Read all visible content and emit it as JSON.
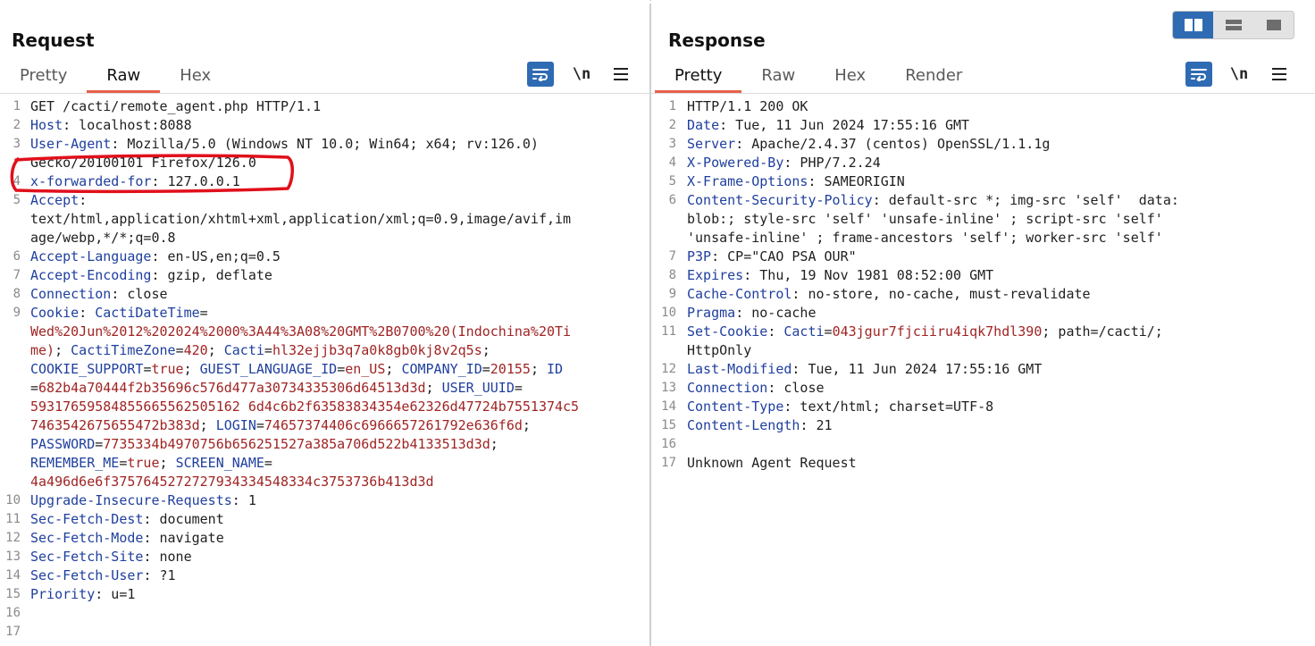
{
  "request": {
    "title": "Request",
    "tabs": [
      {
        "label": "Pretty",
        "active": false
      },
      {
        "label": "Raw",
        "active": true
      },
      {
        "label": "Hex",
        "active": false
      }
    ],
    "lines": [
      {
        "num": "1",
        "parts": [
          [
            "v",
            "GET /cacti/remote_agent.php HTTP/1.1"
          ]
        ]
      },
      {
        "num": "2",
        "parts": [
          [
            "k",
            "Host"
          ],
          [
            "v",
            ": localhost:8088"
          ]
        ]
      },
      {
        "num": "3",
        "parts": [
          [
            "k",
            "User-Agent"
          ],
          [
            "v",
            ": Mozilla/5.0 (Windows NT 10.0; Win64; x64; rv:126.0)"
          ]
        ]
      },
      {
        "num": "",
        "parts": [
          [
            "v",
            "Gecko/20100101 Firefox/126.0"
          ]
        ]
      },
      {
        "num": "4",
        "parts": [
          [
            "k",
            "x-forwarded-for"
          ],
          [
            "v",
            ": 127.0.0.1"
          ]
        ]
      },
      {
        "num": "5",
        "parts": [
          [
            "k",
            "Accept"
          ],
          [
            "v",
            ":"
          ]
        ]
      },
      {
        "num": "",
        "parts": [
          [
            "v",
            "text/html,application/xhtml+xml,application/xml;q=0.9,image/avif,im"
          ]
        ]
      },
      {
        "num": "",
        "parts": [
          [
            "v",
            "age/webp,*/*;q=0.8"
          ]
        ]
      },
      {
        "num": "6",
        "parts": [
          [
            "k",
            "Accept-Language"
          ],
          [
            "v",
            ": en-US,en;q=0.5"
          ]
        ]
      },
      {
        "num": "7",
        "parts": [
          [
            "k",
            "Accept-Encoding"
          ],
          [
            "v",
            ": gzip, deflate"
          ]
        ]
      },
      {
        "num": "8",
        "parts": [
          [
            "k",
            "Connection"
          ],
          [
            "v",
            ": close"
          ]
        ]
      },
      {
        "num": "9",
        "parts": [
          [
            "k",
            "Cookie"
          ],
          [
            "v",
            ": "
          ],
          [
            "k",
            "CactiDateTime"
          ],
          [
            "v",
            "="
          ]
        ]
      },
      {
        "num": "",
        "parts": [
          [
            "c",
            "Wed%20Jun%2012%202024%2000%3A44%3A08%20GMT%2B0700%20(Indochina%20Ti"
          ]
        ]
      },
      {
        "num": "",
        "parts": [
          [
            "c",
            "me)"
          ],
          [
            "v",
            "; "
          ],
          [
            "k",
            "CactiTimeZone"
          ],
          [
            "v",
            "="
          ],
          [
            "c",
            "420"
          ],
          [
            "v",
            "; "
          ],
          [
            "k",
            "Cacti"
          ],
          [
            "v",
            "="
          ],
          [
            "c",
            "hl32ejjb3q7a0k8gb0kj8v2q5s"
          ],
          [
            "v",
            ";"
          ]
        ]
      },
      {
        "num": "",
        "parts": [
          [
            "k",
            "COOKIE_SUPPORT"
          ],
          [
            "v",
            "="
          ],
          [
            "c",
            "true"
          ],
          [
            "v",
            "; "
          ],
          [
            "k",
            "GUEST_LANGUAGE_ID"
          ],
          [
            "v",
            "="
          ],
          [
            "c",
            "en_US"
          ],
          [
            "v",
            "; "
          ],
          [
            "k",
            "COMPANY_ID"
          ],
          [
            "v",
            "="
          ],
          [
            "c",
            "20155"
          ],
          [
            "v",
            "; "
          ],
          [
            "k",
            "ID"
          ]
        ]
      },
      {
        "num": "",
        "parts": [
          [
            "v",
            "="
          ],
          [
            "c",
            "682b4a70444f2b35696c576d477a30734335306d64513d3d"
          ],
          [
            "v",
            "; "
          ],
          [
            "k",
            "USER_UUID"
          ],
          [
            "v",
            "="
          ]
        ]
      },
      {
        "num": "",
        "parts": [
          [
            "c",
            "59317659584855665562505162 6d4c6b2f63583834354e62326d47724b7551374c5"
          ]
        ]
      },
      {
        "num": "",
        "parts": [
          [
            "c",
            "7463542675655472b383d"
          ],
          [
            "v",
            "; "
          ],
          [
            "k",
            "LOGIN"
          ],
          [
            "v",
            "="
          ],
          [
            "c",
            "74657374406c6966657261792e636f6d"
          ],
          [
            "v",
            ";"
          ]
        ]
      },
      {
        "num": "",
        "parts": [
          [
            "k",
            "PASSWORD"
          ],
          [
            "v",
            "="
          ],
          [
            "c",
            "7735334b4970756b656251527a385a706d522b4133513d3d"
          ],
          [
            "v",
            ";"
          ]
        ]
      },
      {
        "num": "",
        "parts": [
          [
            "k",
            "REMEMBER_ME"
          ],
          [
            "v",
            "="
          ],
          [
            "c",
            "true"
          ],
          [
            "v",
            "; "
          ],
          [
            "k",
            "SCREEN_NAME"
          ],
          [
            "v",
            "="
          ]
        ]
      },
      {
        "num": "",
        "parts": [
          [
            "c",
            "4a496d6e6f3757645272727934334548334c3753736b413d3d"
          ]
        ]
      },
      {
        "num": "10",
        "parts": [
          [
            "k",
            "Upgrade-Insecure-Requests"
          ],
          [
            "v",
            ": 1"
          ]
        ]
      },
      {
        "num": "11",
        "parts": [
          [
            "k",
            "Sec-Fetch-Dest"
          ],
          [
            "v",
            ": document"
          ]
        ]
      },
      {
        "num": "12",
        "parts": [
          [
            "k",
            "Sec-Fetch-Mode"
          ],
          [
            "v",
            ": navigate"
          ]
        ]
      },
      {
        "num": "13",
        "parts": [
          [
            "k",
            "Sec-Fetch-Site"
          ],
          [
            "v",
            ": none"
          ]
        ]
      },
      {
        "num": "14",
        "parts": [
          [
            "k",
            "Sec-Fetch-User"
          ],
          [
            "v",
            ": ?1"
          ]
        ]
      },
      {
        "num": "15",
        "parts": [
          [
            "k",
            "Priority"
          ],
          [
            "v",
            ": u=1"
          ]
        ]
      },
      {
        "num": "16",
        "parts": []
      },
      {
        "num": "17",
        "parts": []
      }
    ]
  },
  "response": {
    "title": "Response",
    "tabs": [
      {
        "label": "Pretty",
        "active": true
      },
      {
        "label": "Raw",
        "active": false
      },
      {
        "label": "Hex",
        "active": false
      },
      {
        "label": "Render",
        "active": false
      }
    ],
    "lines": [
      {
        "num": "1",
        "parts": [
          [
            "v",
            "HTTP/1.1 200 OK"
          ]
        ],
        "highlight": true
      },
      {
        "num": "2",
        "parts": [
          [
            "k",
            "Date"
          ],
          [
            "v",
            ": Tue, 11 Jun 2024 17:55:16 GMT"
          ]
        ]
      },
      {
        "num": "3",
        "parts": [
          [
            "k",
            "Server"
          ],
          [
            "v",
            ": Apache/2.4.37 (centos) OpenSSL/1.1.1g"
          ]
        ]
      },
      {
        "num": "4",
        "parts": [
          [
            "k",
            "X-Powered-By"
          ],
          [
            "v",
            ": PHP/7.2.24"
          ]
        ]
      },
      {
        "num": "5",
        "parts": [
          [
            "k",
            "X-Frame-Options"
          ],
          [
            "v",
            ": SAMEORIGIN"
          ]
        ]
      },
      {
        "num": "6",
        "parts": [
          [
            "k",
            "Content-Security-Policy"
          ],
          [
            "v",
            ": default-src *; img-src 'self'  data:"
          ]
        ]
      },
      {
        "num": "",
        "parts": [
          [
            "v",
            "blob:; style-src 'self' 'unsafe-inline' ; script-src 'self'"
          ]
        ]
      },
      {
        "num": "",
        "parts": [
          [
            "v",
            "'unsafe-inline' ; frame-ancestors 'self'; worker-src 'self'"
          ]
        ]
      },
      {
        "num": "7",
        "parts": [
          [
            "k",
            "P3P"
          ],
          [
            "v",
            ": CP=\"CAO PSA OUR\""
          ]
        ]
      },
      {
        "num": "8",
        "parts": [
          [
            "k",
            "Expires"
          ],
          [
            "v",
            ": Thu, 19 Nov 1981 08:52:00 GMT"
          ]
        ]
      },
      {
        "num": "9",
        "parts": [
          [
            "k",
            "Cache-Control"
          ],
          [
            "v",
            ": no-store, no-cache, must-revalidate"
          ]
        ]
      },
      {
        "num": "10",
        "parts": [
          [
            "k",
            "Pragma"
          ],
          [
            "v",
            ": no-cache"
          ]
        ]
      },
      {
        "num": "11",
        "parts": [
          [
            "k",
            "Set-Cookie"
          ],
          [
            "v",
            ": "
          ],
          [
            "k",
            "Cacti"
          ],
          [
            "v",
            "="
          ],
          [
            "c",
            "043jgur7fjciiru4iqk7hdl390"
          ],
          [
            "v",
            "; path=/cacti/;"
          ]
        ]
      },
      {
        "num": "",
        "parts": [
          [
            "v",
            "HttpOnly"
          ]
        ]
      },
      {
        "num": "12",
        "parts": [
          [
            "k",
            "Last-Modified"
          ],
          [
            "v",
            ": Tue, 11 Jun 2024 17:55:16 GMT"
          ]
        ]
      },
      {
        "num": "13",
        "parts": [
          [
            "k",
            "Connection"
          ],
          [
            "v",
            ": close"
          ]
        ]
      },
      {
        "num": "14",
        "parts": [
          [
            "k",
            "Content-Type"
          ],
          [
            "v",
            ": text/html; charset=UTF-8"
          ]
        ]
      },
      {
        "num": "15",
        "parts": [
          [
            "k",
            "Content-Length"
          ],
          [
            "v",
            ": 21"
          ]
        ]
      },
      {
        "num": "16",
        "parts": []
      },
      {
        "num": "17",
        "parts": [
          [
            "v",
            "Unknown Agent Request"
          ]
        ]
      }
    ]
  },
  "toolbar": {
    "newline_label": "\\n"
  },
  "colors": {
    "accent_tab": "#e8604c",
    "button_blue": "#2f6bb3",
    "header_key": "#1f3f9e",
    "cookie_value": "#a02424",
    "annotation_red": "#e0101b"
  }
}
